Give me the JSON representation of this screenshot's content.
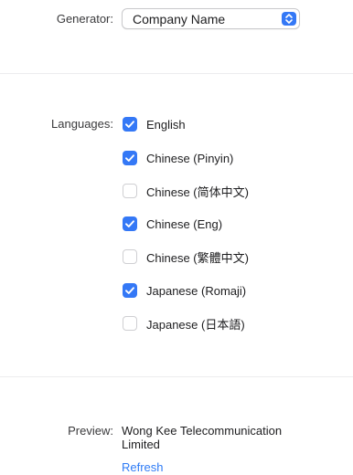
{
  "generator": {
    "label": "Generator:",
    "selected": "Company Name",
    "popup_icon": "up-down-chevron-icon"
  },
  "languages": {
    "label": "Languages:",
    "items": [
      {
        "label": "English",
        "checked": true
      },
      {
        "label": "Chinese (Pinyin)",
        "checked": true
      },
      {
        "label": "Chinese (简体中文)",
        "checked": false
      },
      {
        "label": "Chinese (Eng)",
        "checked": true
      },
      {
        "label": "Chinese (繁體中文)",
        "checked": false
      },
      {
        "label": "Japanese (Romaji)",
        "checked": true
      },
      {
        "label": "Japanese (日本語)",
        "checked": false
      }
    ]
  },
  "preview": {
    "label": "Preview:",
    "text": "Wong Kee Telecommunication Limited",
    "refresh_label": "Refresh"
  },
  "colors": {
    "accent": "#3478f6",
    "link": "#2f7cf6"
  }
}
